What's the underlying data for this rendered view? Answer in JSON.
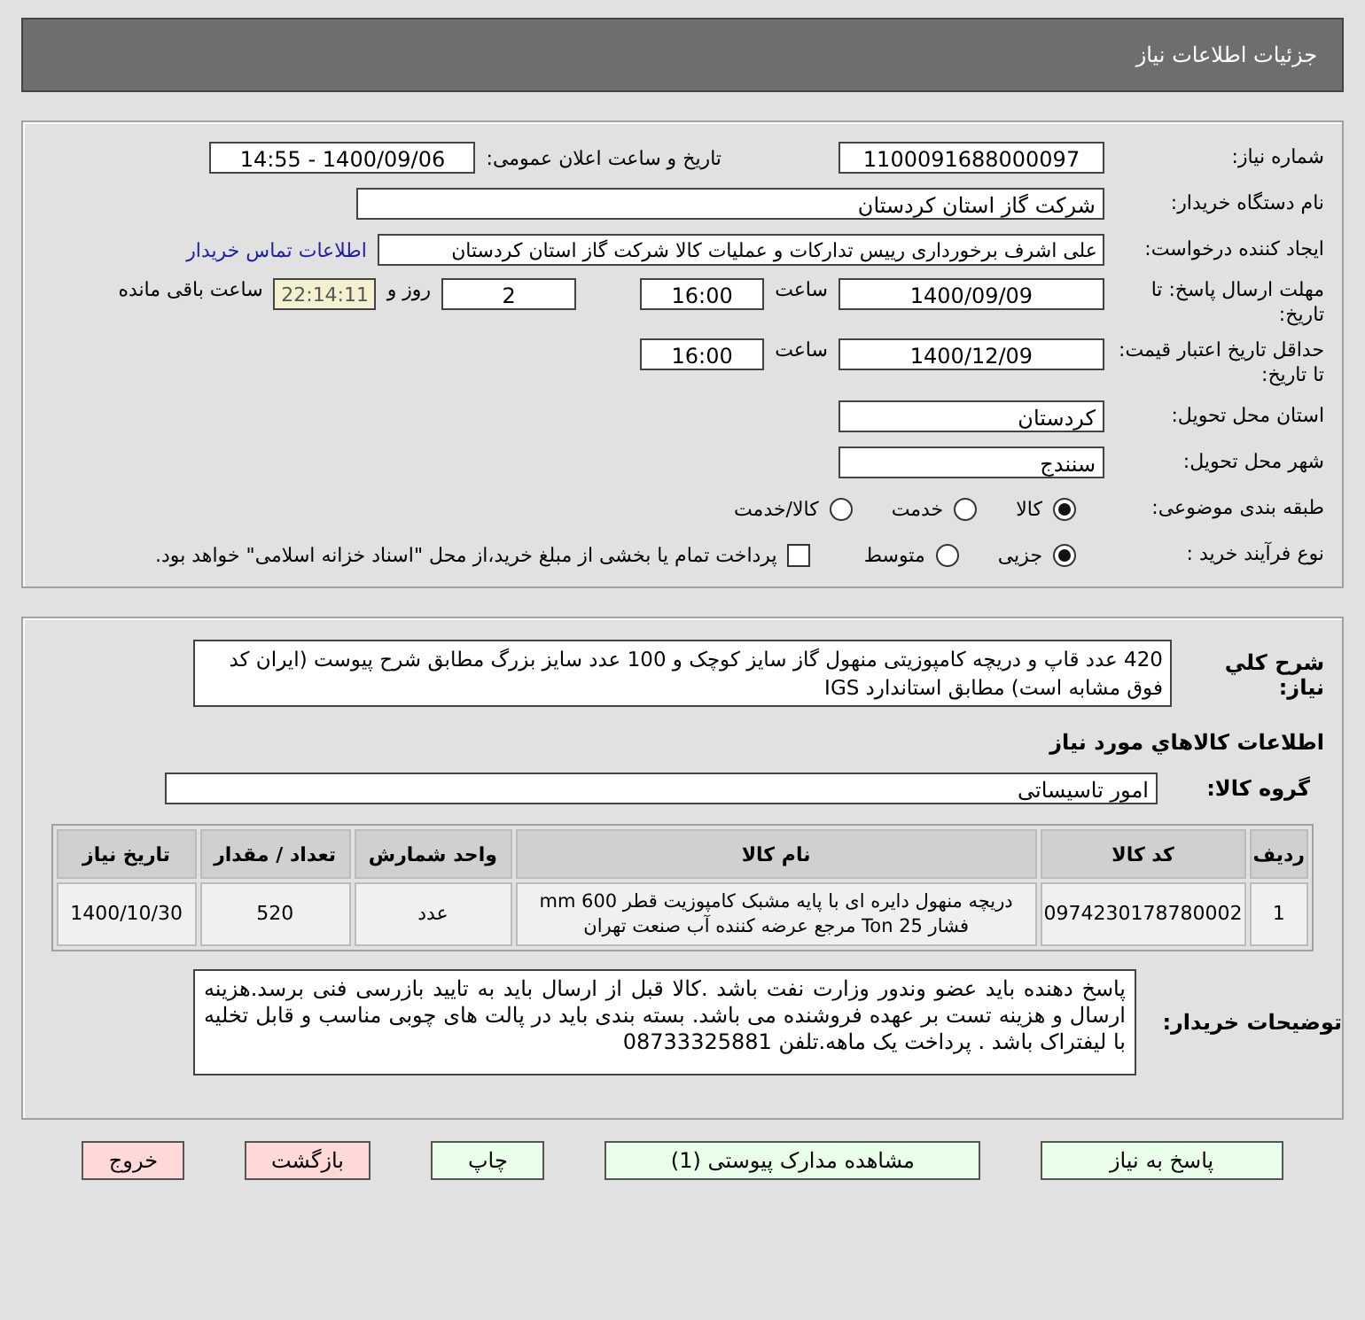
{
  "header": {
    "title": "جزئیات اطلاعات نیاز"
  },
  "need_number": {
    "label": "شماره نیاز:",
    "value": "1100091688000097"
  },
  "announce": {
    "label": "تاریخ و ساعت اعلان عمومی:",
    "value": "1400/09/06 - 14:55"
  },
  "buyer": {
    "label": "نام دستگاه خریدار:",
    "value": "شرکت گاز استان کردستان"
  },
  "creator": {
    "label": "ایجاد کننده درخواست:",
    "value": "علی اشرف برخورداری رییس تدارکات و عملیات کالا شرکت گاز استان کردستان",
    "link": "اطلاعات تماس خریدار"
  },
  "deadline": {
    "label": "مهلت ارسال پاسخ: تا تاریخ:",
    "date": "1400/09/09",
    "time_label": "ساعت",
    "time": "16:00",
    "days": "2",
    "days_label": "روز و",
    "remaining": "22:14:11",
    "remaining_label": "ساعت باقی مانده"
  },
  "validity": {
    "label": "حداقل تاریخ اعتبار قیمت: تا تاریخ:",
    "date": "1400/12/09",
    "time_label": "ساعت",
    "time": "16:00"
  },
  "province": {
    "label": "استان محل تحویل:",
    "value": "کردستان"
  },
  "city": {
    "label": "شهر محل تحویل:",
    "value": "سنندج"
  },
  "classification": {
    "label": "طبقه بندی موضوعی:",
    "options": [
      {
        "label": "کالا",
        "selected": true
      },
      {
        "label": "خدمت",
        "selected": false
      },
      {
        "label": "کالا/خدمت",
        "selected": false
      }
    ]
  },
  "purchase_process": {
    "label": "نوع فرآیند خرید :",
    "options": [
      {
        "label": "جزیی",
        "selected": true
      },
      {
        "label": "متوسط",
        "selected": false
      }
    ],
    "payment": {
      "label": "پرداخت تمام یا بخشی از مبلغ خرید،از محل \"اسناد خزانه اسلامی\" خواهد بود.",
      "checked": false
    }
  },
  "description": {
    "label": "شرح کلي نياز:",
    "value": "420 عدد قاپ و دریچه کامپوزیتی منهول گاز سایز کوچک و 100 عدد سایز بزرگ مطابق شرح پیوست (ایران کد فوق مشابه است) مطابق استاندارد IGS"
  },
  "goods_heading": "اطلاعات کالاهاي مورد نياز",
  "goods_group": {
    "label": "گروه کالا:",
    "value": "امور تاسیساتی"
  },
  "table": {
    "columns": [
      "ردیف",
      "کد کالا",
      "نام کالا",
      "واحد شمارش",
      "تعداد / مقدار",
      "تاریخ نیاز"
    ],
    "rows": [
      {
        "cells": [
          "1",
          "0974230178780002",
          "دریچه منهول دایره ای با پایه مشبک کامپوزیت قطر 600 mm فشار 25 Ton مرجع عرضه کننده آب صنعت تهران",
          "عدد",
          "520",
          "1400/10/30"
        ]
      }
    ]
  },
  "buyer_notes": {
    "label": "توضیحات خریدار:",
    "value": "پاسخ دهنده باید عضو وندور وزارت نفت باشد .کالا قبل از ارسال باید به تایید بازرسی فنی  برسد.هزینه ارسال و  هزینه تست بر عهده فروشنده می باشد. بسته بندی باید در پالت های چوبی مناسب و قابل تخلیه با لیفتراک باشد . پرداخت یک ماهه.تلفن 08733325881"
  },
  "buttons": [
    {
      "label": "پاسخ به نیاز",
      "kind": "action"
    },
    {
      "label": "مشاهده مدارک پیوستی (1)",
      "kind": "action"
    },
    {
      "label": "چاپ",
      "kind": "action"
    },
    {
      "label": "بازگشت",
      "kind": "exit"
    },
    {
      "label": "خروج",
      "kind": "exit"
    }
  ]
}
